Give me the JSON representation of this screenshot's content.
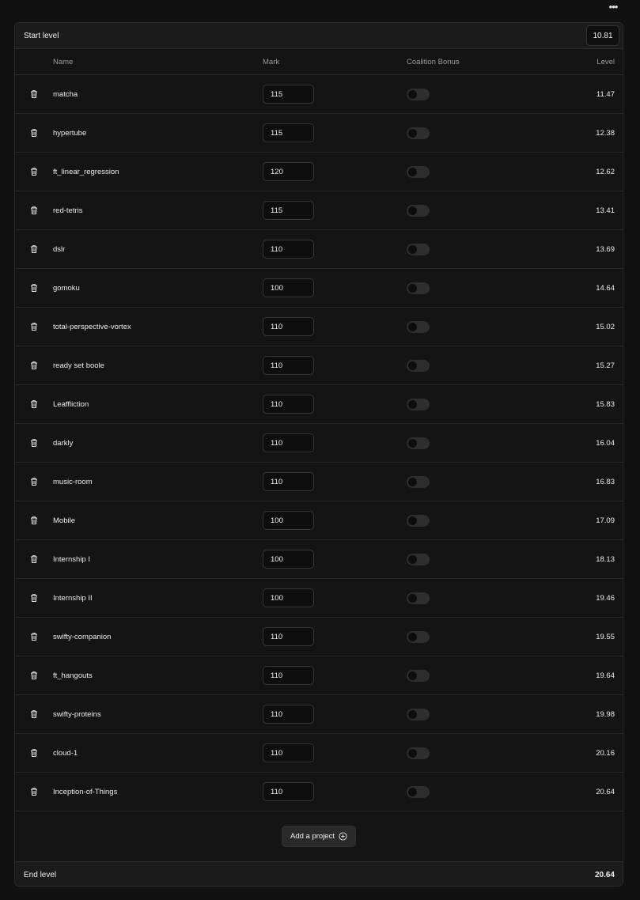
{
  "header": {
    "more_label": "•••"
  },
  "start": {
    "label": "Start level",
    "value": "10.81"
  },
  "columns": {
    "name": "Name",
    "mark": "Mark",
    "bonus": "Coalition Bonus",
    "level": "Level"
  },
  "projects": [
    {
      "name": "matcha",
      "mark": "115",
      "bonus": false,
      "level": "11.47"
    },
    {
      "name": "hypertube",
      "mark": "115",
      "bonus": false,
      "level": "12.38"
    },
    {
      "name": "ft_linear_regression",
      "mark": "120",
      "bonus": false,
      "level": "12.62"
    },
    {
      "name": "red-tetris",
      "mark": "115",
      "bonus": false,
      "level": "13.41"
    },
    {
      "name": "dslr",
      "mark": "110",
      "bonus": false,
      "level": "13.69"
    },
    {
      "name": "gomoku",
      "mark": "100",
      "bonus": false,
      "level": "14.64"
    },
    {
      "name": "total-perspective-vortex",
      "mark": "110",
      "bonus": false,
      "level": "15.02"
    },
    {
      "name": "ready set boole",
      "mark": "110",
      "bonus": false,
      "level": "15.27"
    },
    {
      "name": "Leaffliction",
      "mark": "110",
      "bonus": false,
      "level": "15.83"
    },
    {
      "name": "darkly",
      "mark": "110",
      "bonus": false,
      "level": "16.04"
    },
    {
      "name": "music-room",
      "mark": "110",
      "bonus": false,
      "level": "16.83"
    },
    {
      "name": "Mobile",
      "mark": "100",
      "bonus": false,
      "level": "17.09"
    },
    {
      "name": "Internship I",
      "mark": "100",
      "bonus": false,
      "level": "18.13"
    },
    {
      "name": "Internship II",
      "mark": "100",
      "bonus": false,
      "level": "19.46"
    },
    {
      "name": "swifty-companion",
      "mark": "110",
      "bonus": false,
      "level": "19.55"
    },
    {
      "name": "ft_hangouts",
      "mark": "110",
      "bonus": false,
      "level": "19.64"
    },
    {
      "name": "swifty-proteins",
      "mark": "110",
      "bonus": false,
      "level": "19.98"
    },
    {
      "name": "cloud-1",
      "mark": "110",
      "bonus": false,
      "level": "20.16"
    },
    {
      "name": "Inception-of-Things",
      "mark": "110",
      "bonus": false,
      "level": "20.64"
    }
  ],
  "add_button": {
    "label": "Add a project",
    "icon": "plus-circle-icon"
  },
  "end": {
    "label": "End level",
    "value": "20.64"
  },
  "colors": {
    "background": "#111111",
    "panel": "#141414",
    "border": "#2b2b2b",
    "toggle_off": "#2e2e2e"
  }
}
